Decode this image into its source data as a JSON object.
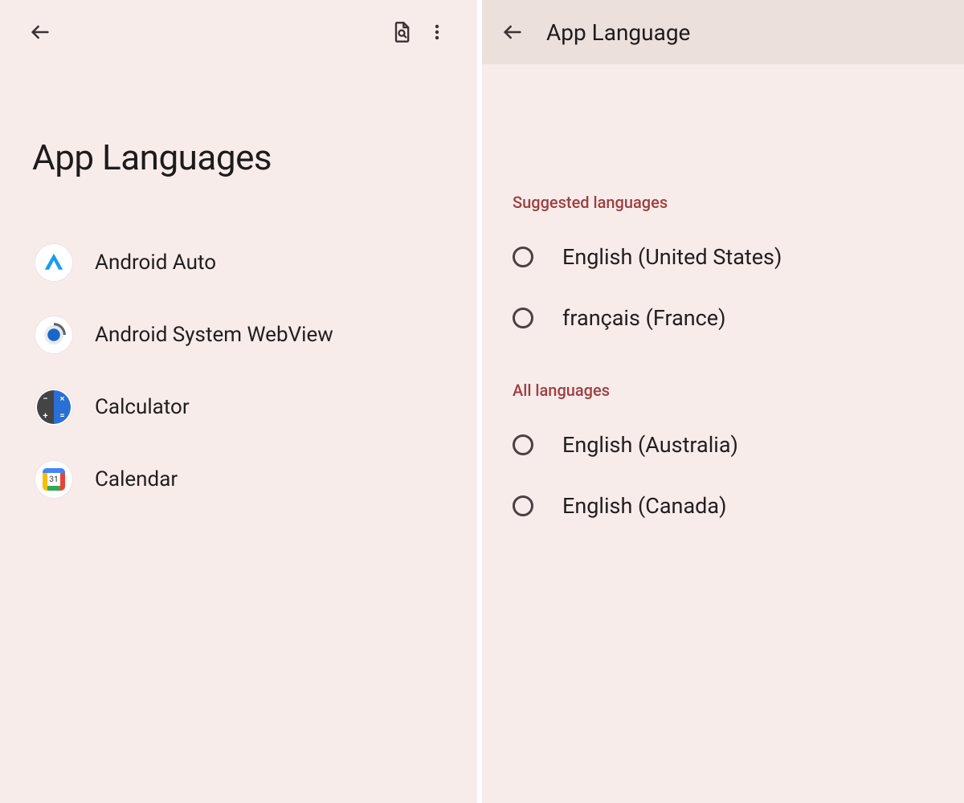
{
  "left": {
    "title": "App Languages",
    "apps": [
      {
        "id": "android-auto",
        "label": "Android Auto"
      },
      {
        "id": "android-system-webview",
        "label": "Android System WebView"
      },
      {
        "id": "calculator",
        "label": "Calculator"
      },
      {
        "id": "calendar",
        "label": "Calendar",
        "calendar_day": "31"
      }
    ]
  },
  "right": {
    "title": "App Language",
    "sections": {
      "suggested": {
        "header": "Suggested languages",
        "items": [
          {
            "label": "English (United States)",
            "selected": false
          },
          {
            "label": "français (France)",
            "selected": false
          }
        ]
      },
      "all": {
        "header": "All languages",
        "items": [
          {
            "label": "English (Australia)",
            "selected": false
          },
          {
            "label": "English (Canada)",
            "selected": false
          }
        ]
      }
    }
  },
  "colors": {
    "bg": "#f8eceb",
    "header_bg_right": "#ece0dd",
    "accent_text": "#9c4041",
    "text": "#221e1f"
  }
}
